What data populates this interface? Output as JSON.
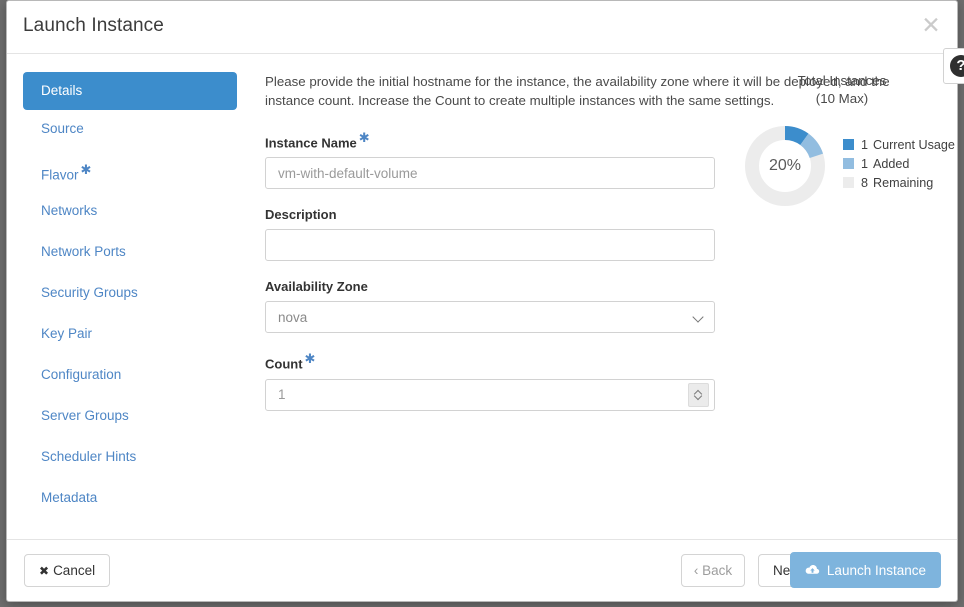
{
  "modal": {
    "title": "Launch Instance",
    "close_icon": "close-icon",
    "help_icon": "question-mark-icon",
    "help_label": "?"
  },
  "sidebar": {
    "items": [
      {
        "label": "Details",
        "required": false,
        "active": true
      },
      {
        "label": "Source",
        "required": false,
        "active": false
      },
      {
        "label": "Flavor",
        "required": true,
        "active": false
      },
      {
        "label": "Networks",
        "required": false,
        "active": false
      },
      {
        "label": "Network Ports",
        "required": false,
        "active": false
      },
      {
        "label": "Security Groups",
        "required": false,
        "active": false
      },
      {
        "label": "Key Pair",
        "required": false,
        "active": false
      },
      {
        "label": "Configuration",
        "required": false,
        "active": false
      },
      {
        "label": "Server Groups",
        "required": false,
        "active": false
      },
      {
        "label": "Scheduler Hints",
        "required": false,
        "active": false
      },
      {
        "label": "Metadata",
        "required": false,
        "active": false
      }
    ]
  },
  "form": {
    "intro": "Please provide the initial hostname for the instance, the availability zone where it will be deployed, and the instance count. Increase the Count to create multiple instances with the same settings.",
    "instance_name": {
      "label": "Instance Name",
      "required_marker": "*",
      "value": "",
      "placeholder": "vm-with-default-volume"
    },
    "description": {
      "label": "Description",
      "value": "",
      "placeholder": ""
    },
    "availability_zone": {
      "label": "Availability Zone",
      "selected": "nova",
      "options": [
        "nova"
      ]
    },
    "count": {
      "label": "Count",
      "required_marker": "*",
      "value": "1",
      "placeholder": "1"
    }
  },
  "quota": {
    "title": "Total Instances",
    "subtitle": "(10 Max)",
    "percent_label": "20%"
  },
  "chart_data": {
    "type": "pie",
    "title": "Total Instances (10 Max)",
    "center_label": "20%",
    "max": 10,
    "categories": [
      "Current Usage",
      "Added",
      "Remaining"
    ],
    "values": [
      1,
      1,
      8
    ],
    "colors": [
      "#3c8dcc",
      "#92bde0",
      "#ececec"
    ],
    "legend": [
      {
        "value": "1",
        "label": "Current Usage",
        "color": "#3c8dcc"
      },
      {
        "value": "1",
        "label": "Added",
        "color": "#92bde0"
      },
      {
        "value": "8",
        "label": "Remaining",
        "color": "#ececec"
      }
    ],
    "legend_position": "right"
  },
  "footer": {
    "cancel": {
      "label": "Cancel",
      "icon": "x-icon"
    },
    "back": {
      "label": "‹ Back",
      "disabled": true
    },
    "next": {
      "label": "Next ›"
    },
    "launch": {
      "label": "Launch Instance",
      "icon": "cloud-upload-icon"
    }
  }
}
